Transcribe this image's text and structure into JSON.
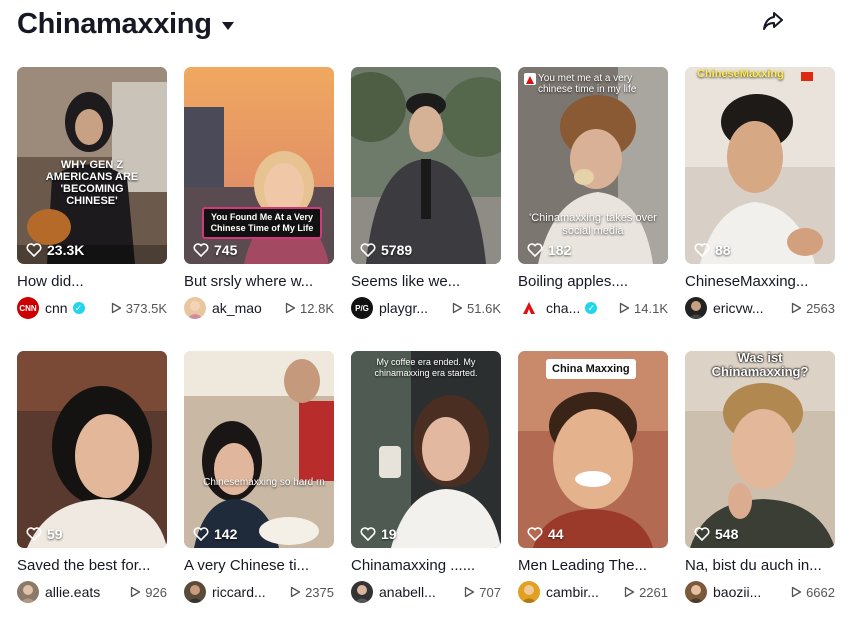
{
  "header": {
    "title": "Chinamaxxing"
  },
  "videos": [
    {
      "likes": "23.3K",
      "caption": "How did...",
      "author": "cnn",
      "verified": true,
      "views": "373.5K",
      "overlay": "WHY GEN Z AMERICANS ARE 'BECOMING CHINESE'",
      "avatar_text": "CNN",
      "avatar_color": "#cc0000"
    },
    {
      "likes": "745",
      "caption": "But srsly where w...",
      "author": "ak_mao",
      "verified": false,
      "views": "12.8K",
      "overlay": "You Found Me At a Very Chinese Time of My Life",
      "avatar_text": "",
      "avatar_color": "#e8c7a0"
    },
    {
      "likes": "5789",
      "caption": "Seems like we...",
      "author": "playgr...",
      "verified": false,
      "views": "51.6K",
      "overlay": "",
      "avatar_text": "P/G",
      "avatar_color": "#111111"
    },
    {
      "likes": "182",
      "caption": "Boiling apples....",
      "author": "cha...",
      "verified": true,
      "views": "14.1K",
      "overlay": "'Chinamaxxing' takes over social media",
      "avatar_text": "A",
      "avatar_color": "#ffffff"
    },
    {
      "likes": "88",
      "caption": "ChineseMaxxing...",
      "author": "ericvw...",
      "verified": false,
      "views": "2563",
      "overlay": "ChineseMaxxing",
      "avatar_text": "",
      "avatar_color": "#222222"
    },
    {
      "likes": "59",
      "caption": "Saved the best for...",
      "author": "allie.eats",
      "verified": false,
      "views": "926",
      "overlay": "",
      "avatar_text": "",
      "avatar_color": "#8a7a6a"
    },
    {
      "likes": "142",
      "caption": "A very Chinese ti...",
      "author": "riccard...",
      "verified": false,
      "views": "2375",
      "overlay": "Chinesemaxxing so hard rn",
      "avatar_text": "",
      "avatar_color": "#5a4a3a"
    },
    {
      "likes": "19",
      "caption": "Chinamaxxing ......",
      "author": "anabell...",
      "verified": false,
      "views": "707",
      "overlay": "My coffee era ended. My chinamaxxing era started.",
      "avatar_text": "",
      "avatar_color": "#333333"
    },
    {
      "likes": "44",
      "caption": "Men Leading The...",
      "author": "cambir...",
      "verified": false,
      "views": "2261",
      "overlay": "China Maxxing",
      "avatar_text": "",
      "avatar_color": "#e0a020"
    },
    {
      "likes": "548",
      "caption": "Na, bist du auch in...",
      "author": "baozii...",
      "verified": false,
      "views": "6662",
      "overlay": "Was ist Chinamaxxing?",
      "avatar_text": "",
      "avatar_color": "#7a5a3a"
    }
  ]
}
